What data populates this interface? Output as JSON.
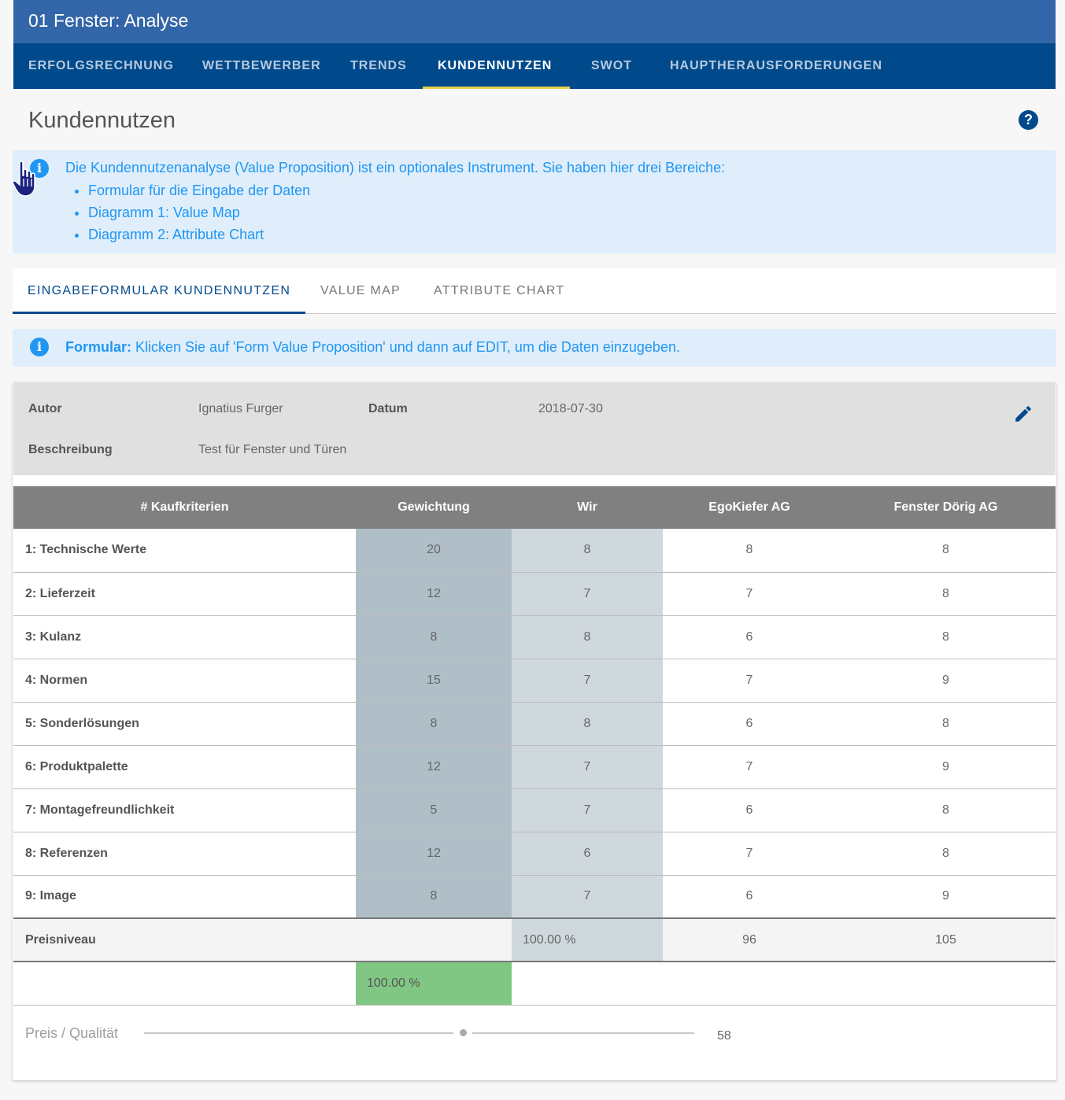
{
  "window": {
    "title": "01 Fenster: Analyse"
  },
  "nav": {
    "items": [
      {
        "label": "ERFOLGSRECHNUNG"
      },
      {
        "label": "WETTBEWERBER"
      },
      {
        "label": "TRENDS"
      },
      {
        "label": "KUNDENNUTZEN"
      },
      {
        "label": "SWOT"
      },
      {
        "label": "HAUPTHERAUSFORDERUNGEN"
      }
    ],
    "active": "KUNDENNUTZEN",
    "underline_color": "#e6d24a"
  },
  "page": {
    "title": "Kundennutzen",
    "help": "?"
  },
  "intro_info": {
    "icon": "info-icon",
    "text": "Die Kundennutzenanalyse (Value Proposition) ist ein optionales Instrument. Sie haben hier drei Bereiche:",
    "bullets": [
      "Formular für die Eingabe der Daten",
      "Diagramm 1: Value Map",
      "Diagramm 2: Attribute Chart"
    ]
  },
  "tabs": {
    "items": [
      {
        "label": "EINGABEFORMULAR KUNDENNUTZEN"
      },
      {
        "label": "VALUE MAP"
      },
      {
        "label": "ATTRIBUTE CHART"
      }
    ],
    "active": "EINGABEFORMULAR KUNDENNUTZEN"
  },
  "form_info": {
    "bold": "Formular:",
    "text": " Klicken Sie auf 'Form Value Proposition' und dann auf EDIT, um die Daten einzugeben."
  },
  "meta": {
    "autor_label": "Autor",
    "autor": "Ignatius Furger",
    "datum_label": "Datum",
    "datum": "2018-07-30",
    "beschreibung_label": "Beschreibung",
    "beschreibung": "Test für Fenster und Türen"
  },
  "table": {
    "headers": [
      "# Kaufkriterien",
      "Gewichtung",
      "Wir",
      "EgoKiefer AG",
      "Fenster Dörig AG"
    ],
    "rows": [
      [
        "1: Technische Werte",
        "20",
        "8",
        "8",
        "8"
      ],
      [
        "2: Lieferzeit",
        "12",
        "7",
        "7",
        "8"
      ],
      [
        "3: Kulanz",
        "8",
        "8",
        "6",
        "8"
      ],
      [
        "4: Normen",
        "15",
        "7",
        "7",
        "9"
      ],
      [
        "5: Sonderlösungen",
        "8",
        "8",
        "6",
        "8"
      ],
      [
        "6: Produktpalette",
        "12",
        "7",
        "7",
        "9"
      ],
      [
        "7: Montagefreundlichkeit",
        "5",
        "7",
        "6",
        "8"
      ],
      [
        "8: Referenzen",
        "12",
        "6",
        "7",
        "8"
      ],
      [
        "9: Image",
        "8",
        "7",
        "6",
        "9"
      ]
    ],
    "preis": {
      "label": "Preisniveau",
      "wir": "100.00 %",
      "egokiefer": "96",
      "doerig": "105"
    },
    "gewichtung_total": "100.00 %"
  },
  "slider": {
    "label": "Preis / Qualität",
    "value": "58",
    "level": 58
  },
  "colors": {
    "topbar": "#3366a8",
    "navbar": "#004a8c",
    "info_bg": "#dfeefa",
    "info_text": "#2196f3",
    "gewichtung_col": "#b0bec8",
    "wir_col": "#cfd8dc",
    "total_ok": "#81c784"
  }
}
